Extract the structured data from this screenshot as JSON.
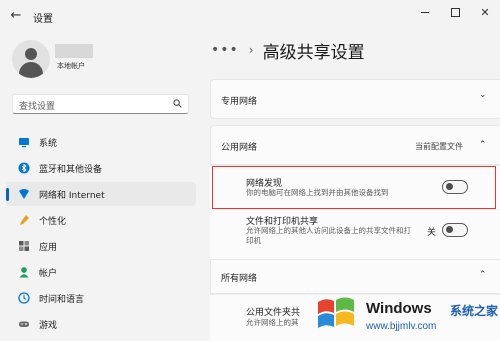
{
  "window": {
    "title": "设置",
    "back_glyph": "←",
    "close_glyph": "✕"
  },
  "profile": {
    "account_type": "本地帐户"
  },
  "search": {
    "placeholder": "查找设置"
  },
  "nav": {
    "items": [
      {
        "label": "系统",
        "icon": "system-icon",
        "color": "#0078d4"
      },
      {
        "label": "蓝牙和其他设备",
        "icon": "bluetooth-icon",
        "color": "#0078d4"
      },
      {
        "label": "网络和 Internet",
        "icon": "network-icon",
        "color": "#0078d4",
        "active": true
      },
      {
        "label": "个性化",
        "icon": "personalization-icon",
        "color": "#e6a117"
      },
      {
        "label": "应用",
        "icon": "apps-icon",
        "color": "#5a5a5a"
      },
      {
        "label": "帐户",
        "icon": "accounts-icon",
        "color": "#1aa05a"
      },
      {
        "label": "时间和语言",
        "icon": "time-language-icon",
        "color": "#0078d4"
      },
      {
        "label": "游戏",
        "icon": "gaming-icon",
        "color": "#6b6b6b"
      }
    ]
  },
  "header": {
    "dots": "•••",
    "chevron": "›",
    "title": "高级共享设置"
  },
  "sections": {
    "private": {
      "label": "专用网络",
      "chevron": "⌄"
    },
    "public": {
      "label": "公用网络",
      "status": "当前配置文件",
      "chevron": "⌃"
    },
    "all": {
      "label": "所有网络",
      "chevron": "⌃"
    }
  },
  "rows": {
    "discovery": {
      "title": "网络发现",
      "desc": "你的电脑可在网络上找到并由其他设备找到",
      "state": "关",
      "on": false
    },
    "file_printer": {
      "title": "文件和打印机共享",
      "desc": "允许网络上的其他人访问此设备上的共享文件和打印机",
      "state": "关",
      "on": false
    },
    "public_folder": {
      "title": "公用文件夹共",
      "desc": "允许网络上的其"
    }
  },
  "watermark": {
    "brand": "Windows",
    "brand_cn": "系统之家",
    "url": "www.bjjmlv.com",
    "accent": "#1e5fb4"
  },
  "accent_color": "#0067c0"
}
